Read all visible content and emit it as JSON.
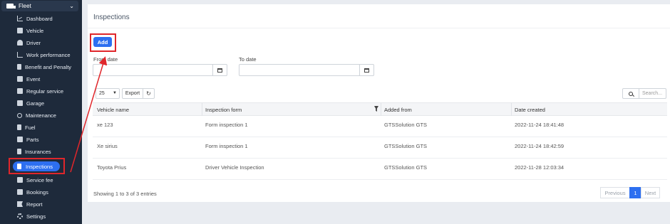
{
  "sidebar": {
    "section_label": "Fleet",
    "items": [
      {
        "label": "Dashboard",
        "icon": "dashboard-icon"
      },
      {
        "label": "Vehicle",
        "icon": "truck-icon"
      },
      {
        "label": "Driver",
        "icon": "user-icon"
      },
      {
        "label": "Work performance",
        "icon": "chart-line-icon"
      },
      {
        "label": "Benefit and Penalty",
        "icon": "document-icon"
      },
      {
        "label": "Event",
        "icon": "calendar-icon"
      },
      {
        "label": "Regular service",
        "icon": "truck-icon"
      },
      {
        "label": "Garage",
        "icon": "garage-icon"
      },
      {
        "label": "Maintenance",
        "icon": "wrench-icon"
      },
      {
        "label": "Fuel",
        "icon": "fuel-icon"
      },
      {
        "label": "Parts",
        "icon": "box-icon"
      },
      {
        "label": "Insurances",
        "icon": "document-icon"
      },
      {
        "label": "Inspections",
        "icon": "document-icon"
      },
      {
        "label": "Service fee",
        "icon": "truck-icon"
      },
      {
        "label": "Bookings",
        "icon": "truck-icon"
      },
      {
        "label": "Report",
        "icon": "flag-icon"
      },
      {
        "label": "Settings",
        "icon": "gear-icon"
      }
    ]
  },
  "page": {
    "title": "Inspections",
    "add_label": "Add",
    "from_date_label": "From date",
    "to_date_label": "To date"
  },
  "table_controls": {
    "page_size": "25",
    "export_label": "Export",
    "search_placeholder": "Search..."
  },
  "table": {
    "columns": [
      "Vehicle name",
      "Inspection form",
      "Added from",
      "Date created"
    ],
    "rows": [
      [
        "xe 123",
        "Form inspection 1",
        "GTSSolution GTS",
        "2022-11-24 18:41:48"
      ],
      [
        "Xe sirius",
        "Form inspection 1",
        "GTSSolution GTS",
        "2022-11-24 18:42:59"
      ],
      [
        "Toyota Prius",
        "Driver Vehicle Inspection",
        "GTSSolution GTS",
        "2022-11-28 12:03:34"
      ]
    ]
  },
  "footer": {
    "info": "Showing 1 to 3 of 3 entries",
    "previous": "Previous",
    "current_page": "1",
    "next": "Next"
  },
  "colors": {
    "accent": "#2d6ff0",
    "sidebar_bg": "#1e2a3b",
    "highlight": "#e0262b"
  }
}
